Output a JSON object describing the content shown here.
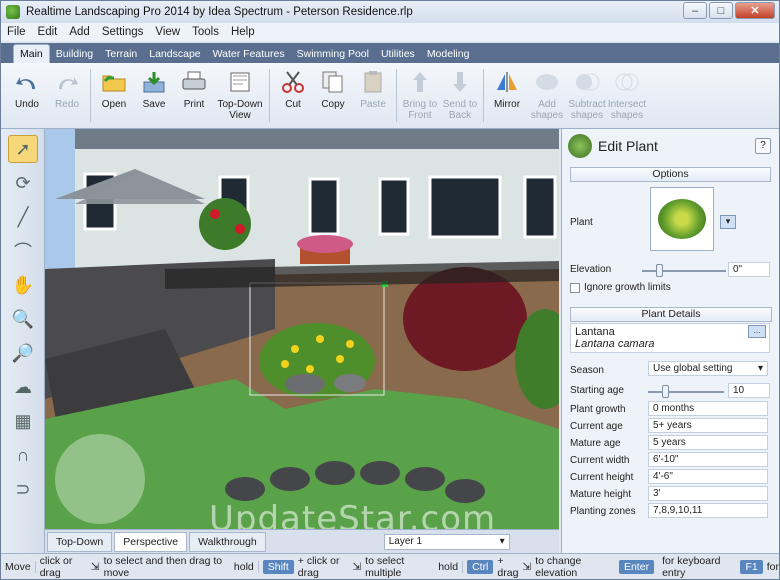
{
  "window": {
    "title": "Realtime Landscaping Pro 2014 by Idea Spectrum - Peterson Residence.rlp"
  },
  "menu": [
    "File",
    "Edit",
    "Add",
    "Settings",
    "View",
    "Tools",
    "Help"
  ],
  "tabs": [
    "Main",
    "Building",
    "Terrain",
    "Landscape",
    "Water Features",
    "Swimming Pool",
    "Utilities",
    "Modeling"
  ],
  "ribbon": {
    "undo": "Undo",
    "redo": "Redo",
    "open": "Open",
    "save": "Save",
    "print": "Print",
    "topdown": "Top-Down View",
    "cut": "Cut",
    "copy": "Copy",
    "paste": "Paste",
    "front": "Bring to Front",
    "back": "Send to Back",
    "mirror": "Mirror",
    "add": "Add shapes",
    "subtract": "Subtract shapes",
    "intersect": "Intersect shapes"
  },
  "viewtabs": [
    "Top-Down",
    "Perspective",
    "Walkthrough"
  ],
  "layer": "Layer 1",
  "panel": {
    "title": "Edit Plant",
    "help": "?",
    "options": "Options",
    "plant_label": "Plant",
    "elevation_label": "Elevation",
    "elevation_value": "0\"",
    "ignore_growth": "Ignore growth limits",
    "details": "Plant Details",
    "plant_name": "Lantana",
    "latin": "Lantana camara",
    "dots": "...",
    "season_label": "Season",
    "season_value": "Use global setting",
    "starting_age_label": "Starting age",
    "starting_age_value": "10",
    "growth_label": "Plant growth",
    "growth_value": "0 months",
    "current_age_label": "Current age",
    "current_age_value": "5+ years",
    "mature_age_label": "Mature age",
    "mature_age_value": "5 years",
    "current_width_label": "Current width",
    "current_width_value": "6'-10\"",
    "current_height_label": "Current height",
    "current_height_value": "4'-6\"",
    "mature_height_label": "Mature height",
    "mature_height_value": "3'",
    "zones_label": "Planting zones",
    "zones_value": "7,8,9,10,11"
  },
  "status": {
    "move": "Move",
    "s1": "click or drag",
    "s2": "to select and then drag to move",
    "hold": "hold",
    "shift": "Shift",
    "s3": "+ click or drag",
    "s4": "to select multiple",
    "hold2": "hold",
    "ctrl": "Ctrl",
    "s5": "+ drag",
    "s6": "to change elevation",
    "enter": "Enter",
    "s7": "for keyboard entry",
    "f1": "F1",
    "s8": "for"
  },
  "watermark": "UpdateStar.com"
}
